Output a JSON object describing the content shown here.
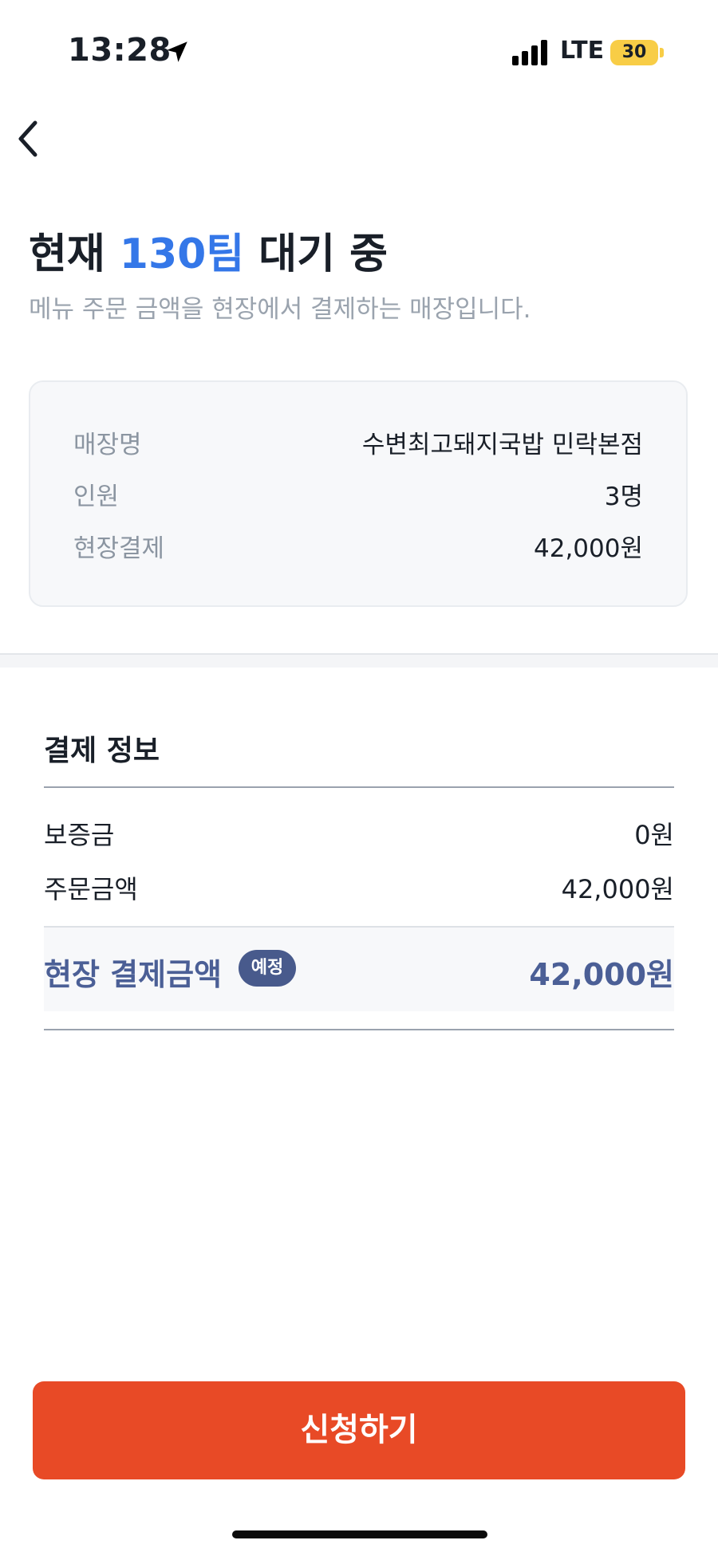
{
  "status_bar": {
    "time": "13:28",
    "network": "LTE",
    "battery": "30"
  },
  "header": {
    "title_prefix": "현재 ",
    "title_count": "130팀",
    "title_suffix": " 대기 중",
    "subtitle": "메뉴 주문 금액을 현장에서 결제하는 매장입니다.",
    "accent_color": "#3477e8"
  },
  "store_info": {
    "rows": [
      {
        "label": "매장명",
        "value": "수변최고돼지국밥 민락본점"
      },
      {
        "label": "인원",
        "value": "3명"
      },
      {
        "label": "현장결제",
        "value": "42,000원"
      }
    ]
  },
  "payment": {
    "section_title": "결제 정보",
    "rows": [
      {
        "label": "보증금",
        "value": "0원"
      },
      {
        "label": "주문금액",
        "value": "42,000원"
      }
    ],
    "total_label": "현장 결제금액",
    "total_badge": "예정",
    "total_value": "42,000원"
  },
  "actions": {
    "apply_label": "신청하기",
    "apply_color": "#e84a26"
  },
  "icons": {
    "back": "back-chevron-icon",
    "location": "location-arrow-icon",
    "signal": "cellular-signal-icon",
    "battery": "battery-icon"
  }
}
